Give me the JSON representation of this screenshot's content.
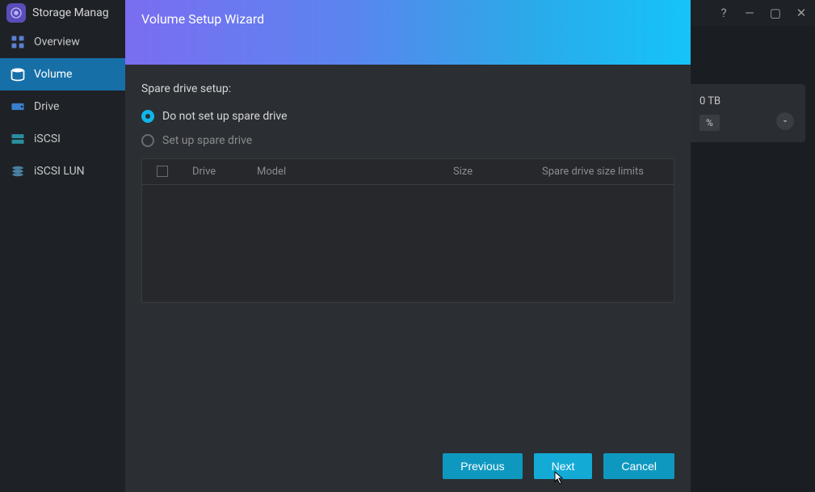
{
  "app": {
    "title": "Storage Manag"
  },
  "sidebar": {
    "items": [
      {
        "label": "Overview",
        "icon": "overview"
      },
      {
        "label": "Volume",
        "icon": "volume",
        "active": true
      },
      {
        "label": "Drive",
        "icon": "drive"
      },
      {
        "label": "iSCSI",
        "icon": "iscsi"
      },
      {
        "label": "iSCSI LUN",
        "icon": "iscsi-lun"
      }
    ]
  },
  "bg_card": {
    "size": "0 TB",
    "percent": "%"
  },
  "wizard": {
    "title": "Volume Setup Wizard",
    "heading": "Spare drive setup:",
    "options": [
      {
        "label": "Do not set up spare drive",
        "selected": true
      },
      {
        "label": "Set up spare drive",
        "selected": false
      }
    ],
    "table": {
      "columns": {
        "drive": "Drive",
        "model": "Model",
        "size": "Size",
        "limits": "Spare drive size limits"
      },
      "rows": []
    },
    "buttons": {
      "previous": "Previous",
      "next": "Next",
      "cancel": "Cancel"
    }
  }
}
